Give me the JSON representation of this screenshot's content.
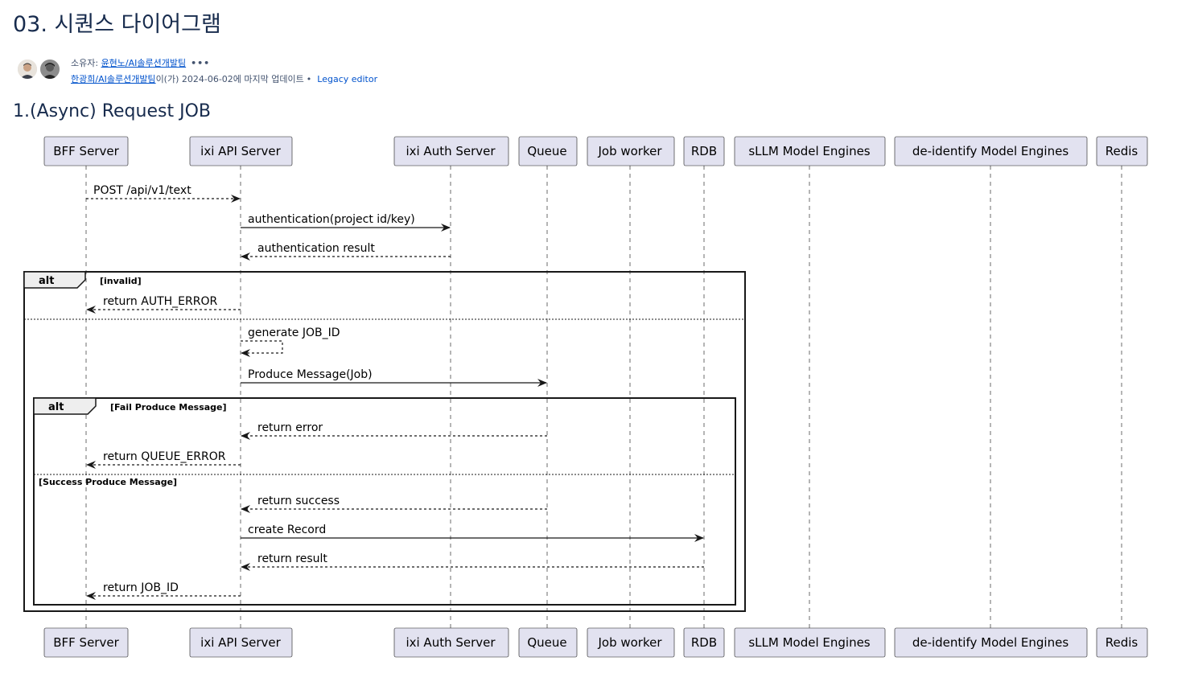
{
  "page": {
    "title": "03. 시퀀스 다이어그램",
    "owner_prefix": "소유자: ",
    "owner_name": "윤현노/AI솔루션개발팀",
    "more": "•••",
    "updater_name": "한광희/AI솔루션개발팀",
    "update_suffix": "이(가) 2024-06-02에 마지막 업데이트",
    "separator": "•",
    "legacy_editor": "Legacy editor",
    "section_heading": "1.(Async) Request JOB"
  },
  "diagram": {
    "participants": [
      "BFF Server",
      "ixi API Server",
      "ixi Auth Server",
      "Queue",
      "Job worker",
      "RDB",
      "sLLM Model Engines",
      "de-identify Model Engines",
      "Redis"
    ],
    "messages": [
      {
        "from": 0,
        "to": 1,
        "label": "POST /api/v1/text",
        "style": "dashed"
      },
      {
        "from": 1,
        "to": 2,
        "label": "authentication(project id/key)",
        "style": "solid"
      },
      {
        "from": 2,
        "to": 1,
        "label": "authentication result",
        "style": "dashed"
      },
      {
        "from": 1,
        "to": 0,
        "label": "return AUTH_ERROR",
        "style": "dashed"
      },
      {
        "from": 1,
        "to": 1,
        "label": "generate JOB_ID",
        "style": "dashed"
      },
      {
        "from": 1,
        "to": 3,
        "label": "Produce Message(Job)",
        "style": "solid"
      },
      {
        "from": 3,
        "to": 1,
        "label": "return error",
        "style": "dashed"
      },
      {
        "from": 1,
        "to": 0,
        "label": "return QUEUE_ERROR",
        "style": "dashed"
      },
      {
        "from": 3,
        "to": 1,
        "label": "return success",
        "style": "dashed"
      },
      {
        "from": 1,
        "to": 5,
        "label": "create Record",
        "style": "solid"
      },
      {
        "from": 5,
        "to": 1,
        "label": "return result",
        "style": "dashed"
      },
      {
        "from": 1,
        "to": 0,
        "label": "return JOB_ID",
        "style": "dashed"
      }
    ],
    "fragments": [
      {
        "tag": "alt",
        "guard": "[invalid]",
        "else_guard": ""
      },
      {
        "tag": "alt",
        "guard": "[Fail Produce Message]",
        "else_guard": "[Success Produce Message]"
      }
    ],
    "colors": {
      "participant_fill": "#e2e2f0",
      "participant_border": "#181818",
      "line": "#181818",
      "lifeline": "#6b6b6b"
    }
  }
}
